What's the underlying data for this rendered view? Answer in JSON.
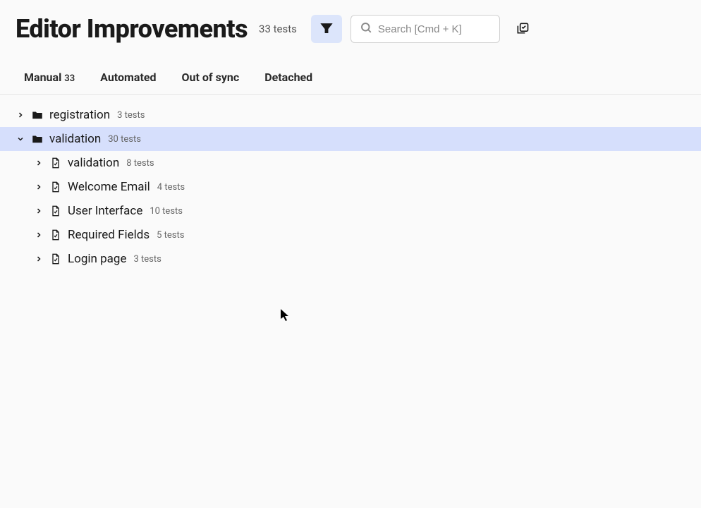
{
  "header": {
    "title": "Editor Improvements",
    "test_count": "33 tests",
    "search_placeholder": "Search [Cmd + K]"
  },
  "tabs": [
    {
      "label": "Manual",
      "count": "33"
    },
    {
      "label": "Automated",
      "count": ""
    },
    {
      "label": "Out of sync",
      "count": ""
    },
    {
      "label": "Detached",
      "count": ""
    }
  ],
  "tree": {
    "folders": [
      {
        "label": "registration",
        "count": "3 tests",
        "expanded": false
      },
      {
        "label": "validation",
        "count": "30 tests",
        "expanded": true
      }
    ],
    "children": [
      {
        "label": "validation",
        "count": "8 tests"
      },
      {
        "label": "Welcome Email",
        "count": "4 tests"
      },
      {
        "label": "User Interface",
        "count": "10 tests"
      },
      {
        "label": "Required Fields",
        "count": "5 tests"
      },
      {
        "label": "Login page",
        "count": "3 tests"
      }
    ]
  }
}
